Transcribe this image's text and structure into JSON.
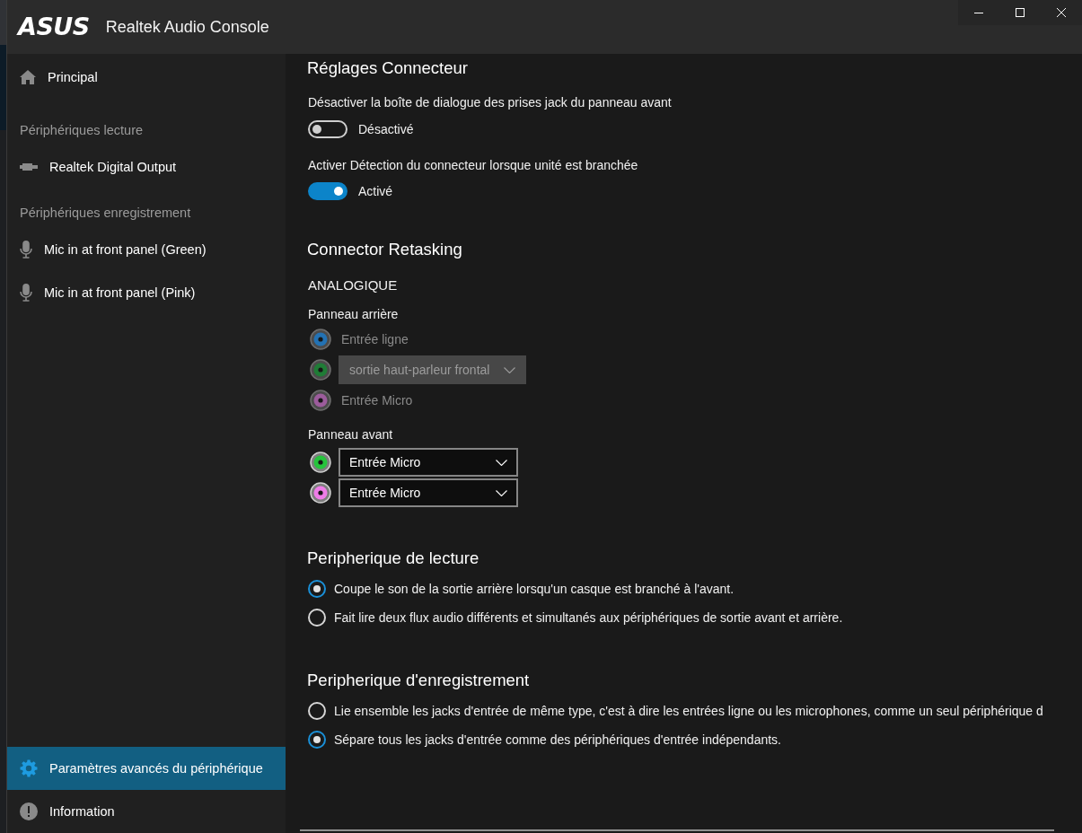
{
  "window": {
    "logo": "ASUS",
    "title": "Realtek Audio Console"
  },
  "sidebar": {
    "top_items": [
      {
        "kind": "home",
        "label": "Principal",
        "selected": false
      }
    ],
    "sections": [
      {
        "title": "Périphériques lecture",
        "items": [
          {
            "kind": "output",
            "label": "Realtek Digital Output",
            "selected": false
          }
        ]
      },
      {
        "title": "Périphériques enregistrement",
        "items": [
          {
            "kind": "input",
            "label": "Mic in at front panel (Green)",
            "selected": false
          },
          {
            "kind": "input",
            "label": "Mic in at front panel (Pink)",
            "selected": false
          }
        ]
      }
    ],
    "bottom_items": [
      {
        "kind": "settings",
        "label": "Paramètres avancés du périphérique",
        "selected": true
      },
      {
        "kind": "info",
        "label": "Information",
        "selected": false
      }
    ]
  },
  "connector_settings": {
    "title": "Réglages Connecteur",
    "options": [
      {
        "label": "Désactiver la boîte de dialogue des prises jack du panneau avant",
        "on": false,
        "state_text": "Désactivé"
      },
      {
        "label": "Activer Détection du connecteur lorsque unité est branchée",
        "on": true,
        "state_text": "Activé"
      }
    ]
  },
  "connector_retasking": {
    "title": "Connector Retasking",
    "group": "ANALOGIQUE",
    "panels": [
      {
        "title": "Panneau arrière",
        "jacks": [
          {
            "kind": "label",
            "color": "#2372b4",
            "label": "Entrée ligne",
            "disabled": true
          },
          {
            "kind": "dropdown",
            "color": "#1f7c36",
            "value": "sortie haut-parleur frontal",
            "disabled": true
          },
          {
            "kind": "label",
            "color": "#9c5c9c",
            "label": "Entrée Micro",
            "disabled": true
          }
        ]
      },
      {
        "title": "Panneau avant",
        "jacks": [
          {
            "kind": "dropdown",
            "color": "#26c43c",
            "value": "Entrée Micro",
            "disabled": false
          },
          {
            "kind": "dropdown",
            "color": "#ee7ce8",
            "value": "Entrée Micro",
            "disabled": false
          }
        ]
      }
    ]
  },
  "playback_device": {
    "title": "Peripherique de lecture",
    "options": [
      {
        "label": "Coupe le son de la sortie arrière lorsqu'un casque est branché à l'avant.",
        "selected": true
      },
      {
        "label": "Fait lire deux flux audio différents et simultanés aux périphériques de sortie avant et arrière.",
        "selected": false
      }
    ]
  },
  "recording_device": {
    "title": "Peripherique d'enregistrement",
    "options": [
      {
        "label": "Lie ensemble les jacks d'entrée de même type, c'est à dire les entrées ligne ou les microphones, comme un seul périphérique d",
        "selected": false
      },
      {
        "label": "Sépare tous les jacks d'entrée comme des périphériques d'entrée indépendants.",
        "selected": true
      }
    ]
  }
}
